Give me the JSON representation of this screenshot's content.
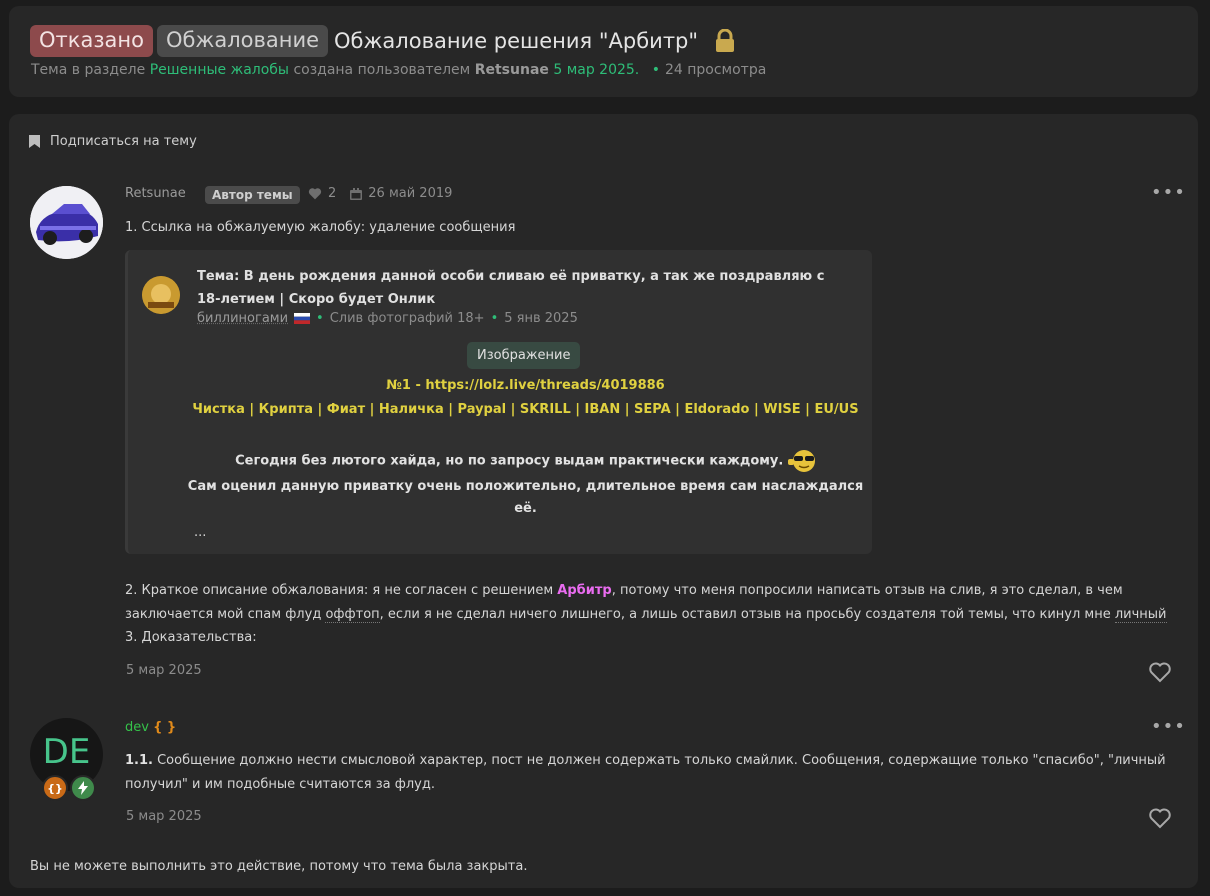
{
  "header": {
    "prefix_denied": "Отказано",
    "prefix_appeal": "Обжалование",
    "title": "Обжалование решения \"Арбитр\"",
    "meta_prefix": "Тема в разделе",
    "section": "Решенные жалобы",
    "meta_created": "создана пользователем",
    "author": "Retsunae",
    "date": "5 мар 2025.",
    "views": "24 просмотра"
  },
  "subscribe_label": "Подписаться на тему",
  "post1": {
    "author": "Retsunae",
    "badge": "Автор темы",
    "likes": "2",
    "reg_date": "26 май 2019",
    "line1": "1. Ссылка на обжалуемую жалобу: удаление сообщения",
    "quote": {
      "title": "Тема: В день рождения данной особи сливаю её приватку, а так же поздравляю с 18-летием | Скоро будет Онлик",
      "user": "биллиногами",
      "category": "Слив фотографий 18+",
      "date": "5 янв 2025",
      "image_label": "Изображение",
      "link_line": "№1 - https://lolz.live/threads/4019886",
      "services_line": "Чистка | Крипта | Фиат | Наличка | Paypal | SKRILL | IBAN | SEPA | Eldorado | WISE | EU/US",
      "text1": "Сегодня без лютого хайда, но по запросу выдам практически каждому.",
      "text2a": "Сам оценил данную приватку очень положительно, длительное время сам наслаждался",
      "text2b": "её.",
      "ellipsis": "..."
    },
    "line2_a": "2. Краткое описание обжалования: я не согласен с решением ",
    "line2_arbitr": "Арбитр",
    "line2_b": ", потому что меня попросили написать отзыв на слив, я это сделал, в чем",
    "line3_a": "заключается мой спам флуд ",
    "line3_offtop": "оффтоп",
    "line3_b": ", если я не сделал ничего лишнего, а лишь оставил отзыв на просьбу создателя той темы, что кинул мне ",
    "line3_personal": "личный",
    "line4": "3. Доказательства:",
    "date": "5 мар 2025",
    "more": "•••"
  },
  "post2": {
    "author": "dev",
    "author_suffix": "{ }",
    "avatar_letters": "DE",
    "rule_num": "1.1.",
    "text_a": " Сообщение должно нести смысловой характер, пост не должен содержать только смайлик. Сообщения, содержащие только \"спасибо\", \"личный",
    "text_b": "получил\" и им подобные считаются за флуд.",
    "date": "5 мар 2025",
    "more": "•••"
  },
  "closed_message": "Вы не можете выполнить это действие, потому что тема была закрыта.",
  "colors": {
    "accent_green": "#2ebd78",
    "denied_badge": "#8d4a4c",
    "quote_yellow": "#e0d140",
    "arbitr_pink": "#ea6cf0"
  }
}
